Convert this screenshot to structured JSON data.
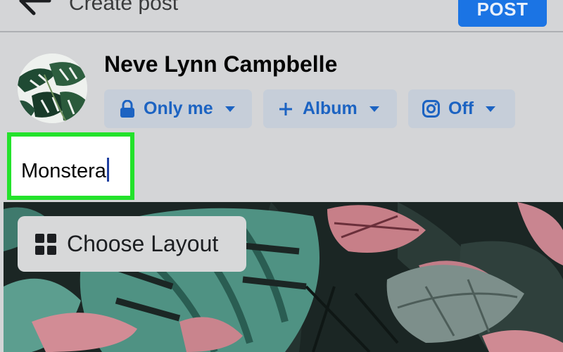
{
  "header": {
    "title": "Create post",
    "post_label": "POST"
  },
  "author": {
    "name": "Neve Lynn Campbelle"
  },
  "audience": {
    "privacy_label": "Only me",
    "album_label": "Album",
    "instagram_label": "Off"
  },
  "composer": {
    "text": "Monstera"
  },
  "photo": {
    "choose_layout_label": "Choose Layout"
  },
  "colors": {
    "accent": "#1b74e4",
    "highlight": "#23e22b",
    "pill_background": "#c6ced9"
  },
  "icons": [
    "back-arrow-icon",
    "lock-icon",
    "plus-icon",
    "instagram-icon",
    "chevron-down-icon",
    "grid-layout-icon"
  ]
}
